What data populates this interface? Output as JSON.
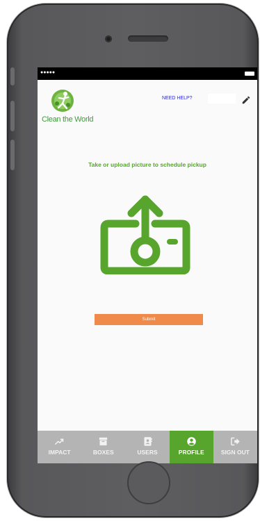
{
  "header": {
    "logo_text": "Clean the World",
    "help_link": "NEED HELP?"
  },
  "main": {
    "prompt": "Take or upload picture to schedule pickup",
    "submit_label": "Submit"
  },
  "tabs": [
    {
      "label": "IMPACT",
      "icon": "trend-up-icon",
      "active": false
    },
    {
      "label": "BOXES",
      "icon": "archive-box-icon",
      "active": false
    },
    {
      "label": "USERS",
      "icon": "contacts-icon",
      "active": false
    },
    {
      "label": "PROFILE",
      "icon": "user-circle-icon",
      "active": true
    },
    {
      "label": "SIGN OUT",
      "icon": "sign-out-icon",
      "active": false
    }
  ],
  "colors": {
    "brand_green": "#58a52e",
    "submit_orange": "#ef8a4b",
    "tabbar_gray": "#b4b4b4",
    "link_blue": "#2b2bd9"
  }
}
